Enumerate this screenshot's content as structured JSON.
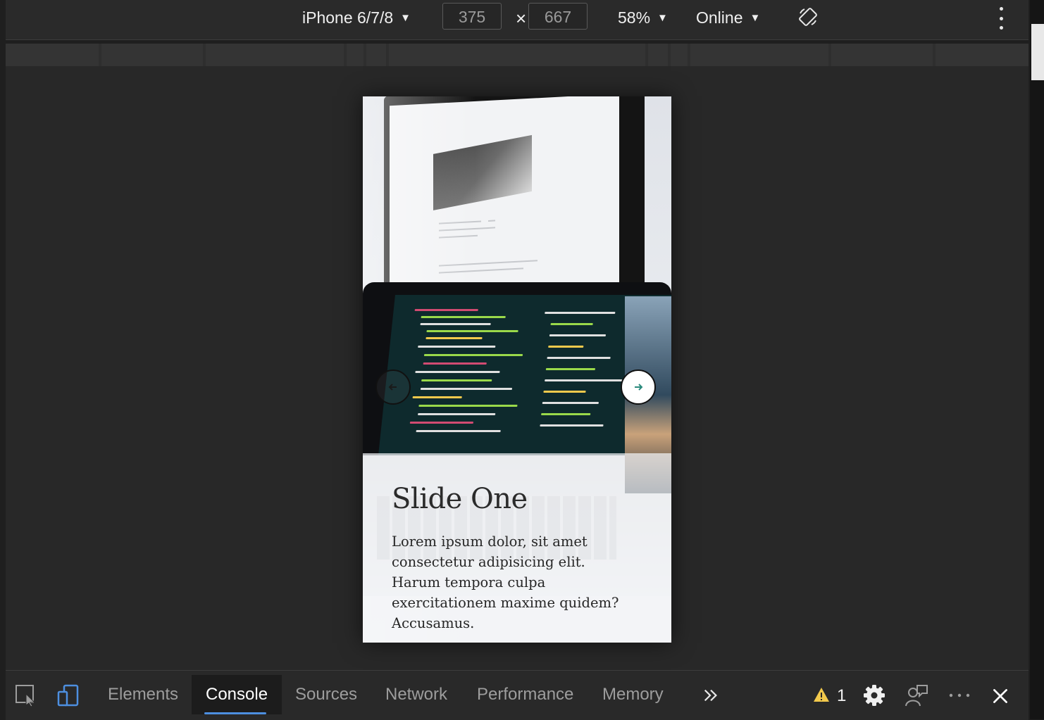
{
  "device_toolbar": {
    "device": "iPhone 6/7/8",
    "width": "375",
    "height": "667",
    "dimension_separator": "×",
    "zoom": "58%",
    "throttle": "Online"
  },
  "slide": {
    "title": "Slide One",
    "text": "Lorem ipsum dolor, sit amet consectetur adipisicing elit. Harum tempora culpa exercitationem maxime quidem? Accusamus."
  },
  "devtools_tabs": [
    "Elements",
    "Console",
    "Sources",
    "Network",
    "Performance",
    "Memory"
  ],
  "active_tab": "Console",
  "warnings": {
    "count": "1",
    "color": "#f2c94c"
  },
  "colors": {
    "accent": "#4d8fe0",
    "panel": "#292929",
    "arrow": "#2a8a7c"
  },
  "icons": {
    "inspect": "inspect-element-icon",
    "device": "device-toggle-icon",
    "rotate": "rotate-icon",
    "more_tabs": "chevron-double-right-icon",
    "settings": "gear-icon",
    "feedback": "feedback-icon",
    "more": "more-horizontal-icon",
    "close": "close-icon"
  }
}
